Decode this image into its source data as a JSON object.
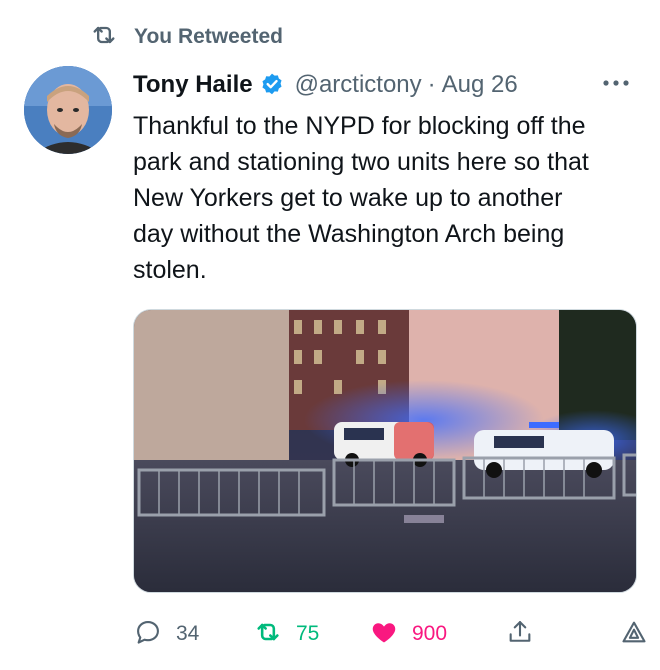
{
  "retweet_header": {
    "label": "You Retweeted",
    "icon": "retweet-icon"
  },
  "tweet": {
    "author_name": "Tony Haile",
    "verified": true,
    "handle": "@arctictony",
    "separator": "·",
    "date": "Aug 26",
    "text_lines": [
      "Thankful to the NYPD for blocking off the",
      "park and stationing two units here so that",
      "New Yorkers get to wake up to another",
      "day without the Washington Arch being",
      "stolen."
    ],
    "media": {
      "type": "photo",
      "icon": "photo"
    }
  },
  "actions": {
    "reply": {
      "icon": "reply-icon",
      "count": "34"
    },
    "retweet": {
      "icon": "retweet-icon",
      "count": "75",
      "active": true
    },
    "like": {
      "icon": "heart-icon",
      "count": "900",
      "active": true
    },
    "share": {
      "icon": "share-icon"
    },
    "analytics": {
      "icon": "analytics-icon"
    }
  },
  "colors": {
    "text": "#0f1419",
    "secondary": "#536471",
    "verified": "#1d9bf0",
    "retweet_active": "#00ba7c",
    "like_active": "#f91880"
  }
}
